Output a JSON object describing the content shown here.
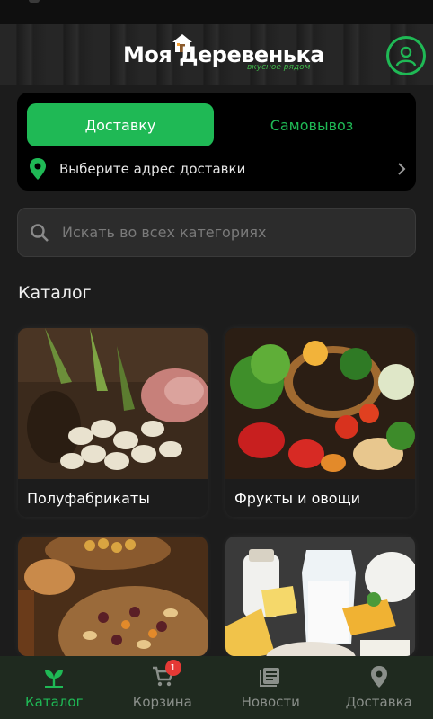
{
  "header": {
    "logo_text": "Моя Деревенька",
    "logo_tagline": "вкусное рядом"
  },
  "delivery": {
    "tabs": [
      {
        "label": "Доставку",
        "active": true
      },
      {
        "label": "Самовывоз",
        "active": false
      }
    ],
    "address_prompt": "Выберите адрес доставки"
  },
  "search": {
    "placeholder": "Искать во всех категориях"
  },
  "catalog": {
    "title": "Каталог",
    "categories": [
      {
        "label": "Полуфабрикаты"
      },
      {
        "label": "Фрукты и овощи"
      },
      {
        "label": ""
      },
      {
        "label": ""
      }
    ]
  },
  "bottom_nav": {
    "items": [
      {
        "label": "Каталог",
        "icon": "sprout-icon",
        "active": true
      },
      {
        "label": "Корзина",
        "icon": "cart-icon",
        "badge": "1"
      },
      {
        "label": "Новости",
        "icon": "news-icon"
      },
      {
        "label": "Доставка",
        "icon": "location-pin-icon"
      }
    ]
  },
  "colors": {
    "accent": "#1fb955",
    "background": "#1c1c1c",
    "card": "#000000",
    "badge": "#e53935"
  }
}
